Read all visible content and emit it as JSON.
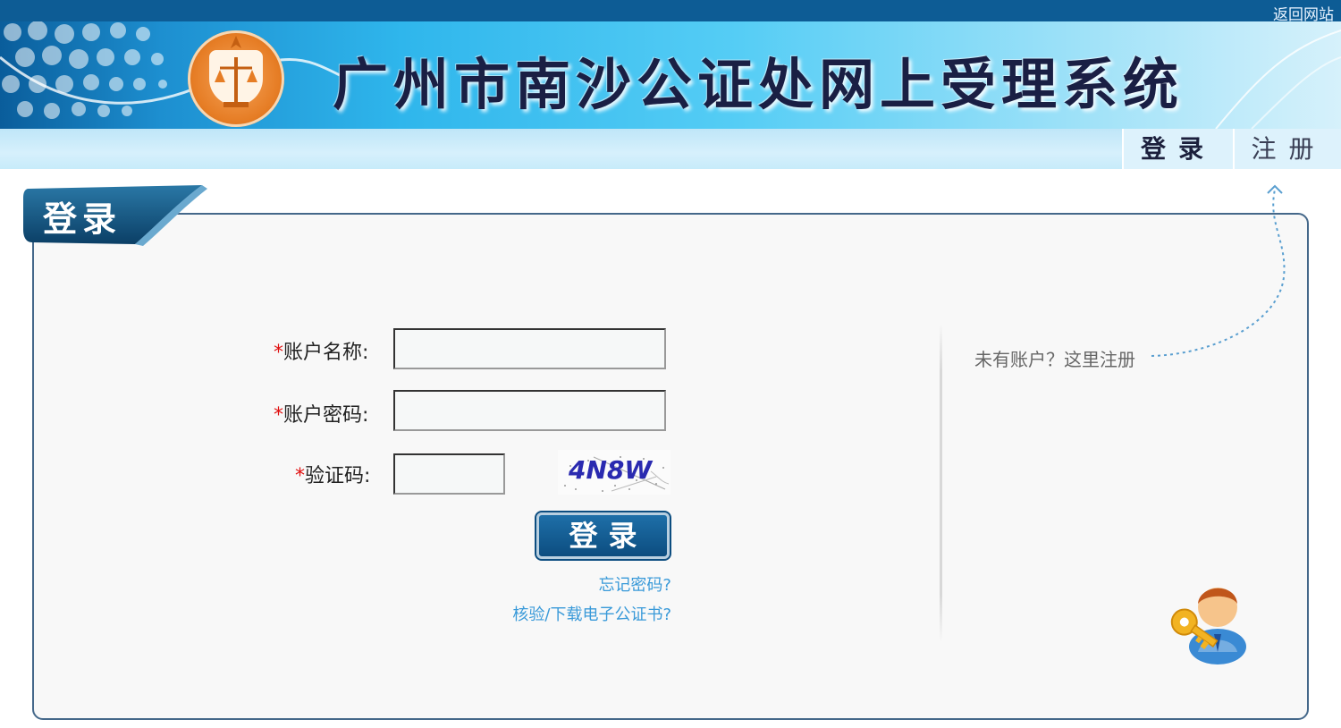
{
  "top": {
    "back_link": "返回网站"
  },
  "header": {
    "title": "广州市南沙公证处网上受理系统"
  },
  "nav": {
    "login": "登录",
    "register": "注册"
  },
  "panel": {
    "tag": "登录"
  },
  "form": {
    "username_label": "账户名称:",
    "password_label": "账户密码:",
    "captcha_label": "验证码:",
    "required_mark": "*",
    "username_value": "",
    "password_value": "",
    "captcha_value": "",
    "captcha_text": "4N8W",
    "submit": "登录",
    "forgot_password": "忘记密码?",
    "verify_download": "核验/下载电子公证书?"
  },
  "side": {
    "register_hint": "未有账户？这里注册"
  },
  "icons": [
    "logo-emblem-icon",
    "user-key-icon"
  ],
  "colors": {
    "brand_dark": "#0d5c95",
    "link": "#3a9ad9",
    "required": "#e01010"
  }
}
